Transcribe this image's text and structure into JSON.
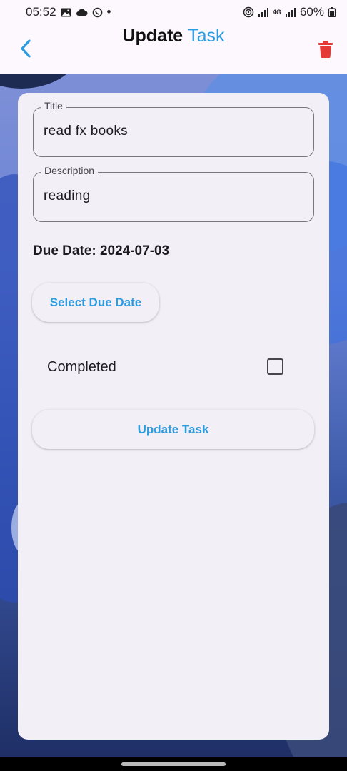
{
  "status_bar": {
    "time": "05:52",
    "dot": "•",
    "network": "4G",
    "battery": "60%"
  },
  "app_bar": {
    "title_bold": "Update",
    "title_accent": "Task",
    "accent_color": "#2b9ce0",
    "delete_color": "#e53935"
  },
  "form": {
    "title_label": "Title",
    "title_value": "read fx books",
    "description_label": "Description",
    "description_value": "reading",
    "due_date_text": "Due Date: 2024-07-03",
    "select_date_label": "Select Due Date",
    "completed_label": "Completed",
    "completed": false,
    "update_label": "Update Task"
  }
}
